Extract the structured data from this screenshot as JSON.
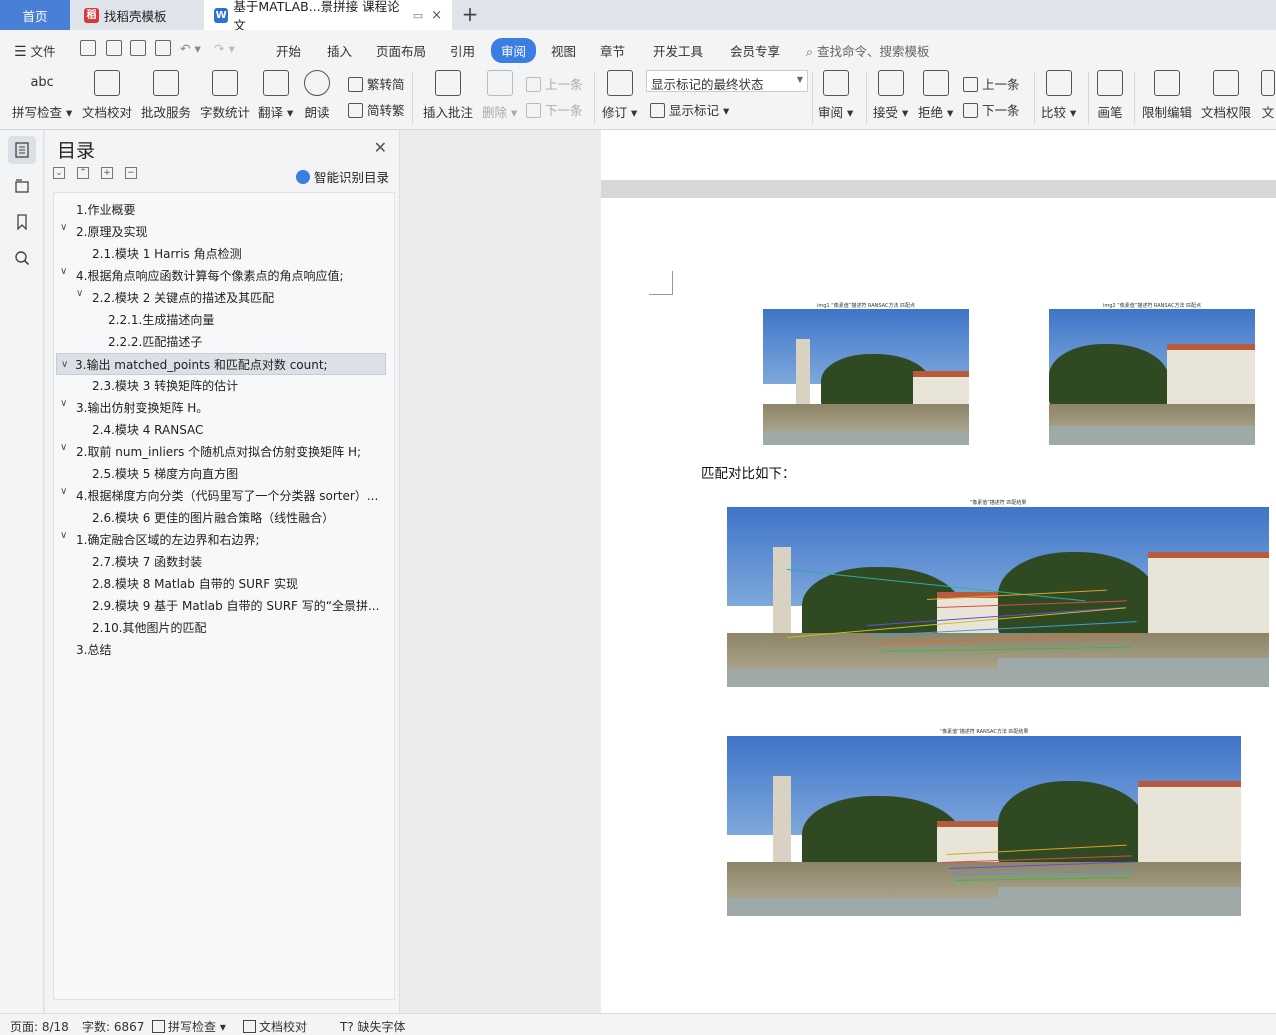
{
  "tabs": {
    "home": "首页",
    "template": "找稻壳模板",
    "document": "基于MATLAB...景拼接 课程论文"
  },
  "menu": {
    "file": "文件",
    "items": [
      "开始",
      "插入",
      "页面布局",
      "引用",
      "审阅",
      "视图",
      "章节",
      "开发工具",
      "会员专享"
    ],
    "active": "审阅",
    "search": "查找命令、搜索模板"
  },
  "ribbon": {
    "spell_check": "拼写检查",
    "doc_proof": "文档校对",
    "batch_service": "批改服务",
    "word_count": "字数统计",
    "translate": "翻译",
    "read_aloud": "朗读",
    "to_traditional": "繁转简",
    "to_simplified": "简转繁",
    "insert_comment": "插入批注",
    "delete": "删除",
    "prev_comment": "上一条",
    "next_comment": "下一条",
    "revise": "修订",
    "markup_state": "显示标记的最终状态",
    "show_markup": "显示标记",
    "review": "审阅",
    "accept": "接受",
    "reject": "拒绝",
    "prev_change": "上一条",
    "next_change": "下一条",
    "compare": "比较",
    "pen": "画笔",
    "restrict_edit": "限制编辑",
    "doc_permission": "文档权限",
    "doc_more": "文"
  },
  "toc": {
    "title": "目录",
    "smart": "智能识别目录",
    "items": [
      "1.作业概要",
      "2.原理及实现",
      "2.1.模块 1 Harris 角点检测",
      "4.根据角点响应函数计算每个像素点的角点响应值;",
      "2.2.模块 2  关键点的描述及其匹配",
      "2.2.1.生成描述向量",
      "2.2.2.匹配描述子",
      "3.输出 matched_points 和匹配点对数 count;",
      "2.3.模块 3  转换矩阵的估计",
      "3.输出仿射变换矩阵 H。",
      "2.4.模块 4 RANSAC",
      "2.取前 num_inliers 个随机点对拟合仿射变换矩阵 H;",
      "2.5.模块 5  梯度方向直方图",
      "4.根据梯度方向分类（代码里写了一个分类器 sorter）...",
      "2.6.模块 6  更佳的图片融合策略（线性融合）",
      "1.确定融合区域的左边界和右边界;",
      "2.7.模块 7  函数封装",
      "2.8.模块 8 Matlab 自带的 SURF 实现",
      "2.9.模块 9  基于 Matlab 自带的 SURF 写的“全景拼...",
      "2.10.其他图片的匹配",
      "3.总结"
    ]
  },
  "document": {
    "caption_img1": "img1 “像素值”描述符 RANSAC方法 匹配点",
    "caption_img2": "img2 “像素值”描述符 RANSAC方法 匹配点",
    "caption_match1": "“像素值”描述符 匹配结果",
    "caption_match2": "“像素值”描述符 RANSAC方法 匹配结果",
    "body_text": "匹配对比如下："
  },
  "status": {
    "page": "页面: 8/18",
    "words": "字数: 6867",
    "spell": "拼写检查",
    "proof": "文档校对",
    "missing_font": "缺失字体"
  },
  "colors": {
    "accent": "#3a7de3",
    "home_tab": "#4a7fd8"
  }
}
